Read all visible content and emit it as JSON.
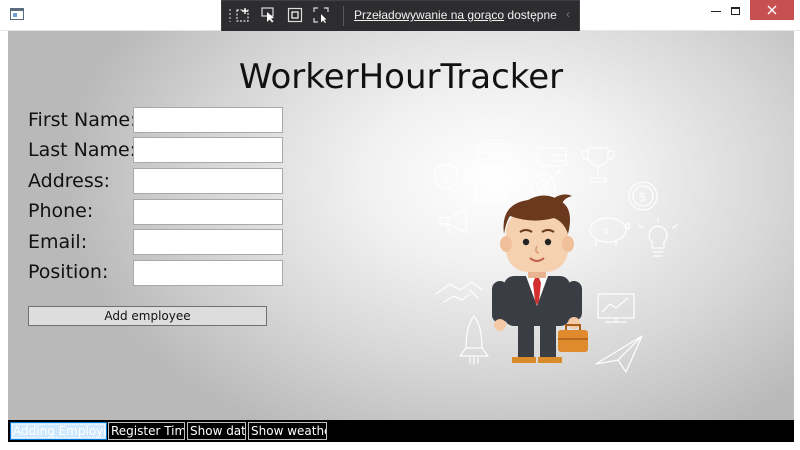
{
  "hot_reload": {
    "link_text": "Przeładowywanie na gorąco",
    "suffix_text": " dostępne"
  },
  "app": {
    "title": "WorkerHourTracker"
  },
  "form": {
    "fields": [
      {
        "label": "First Name:",
        "value": ""
      },
      {
        "label": "Last Name:",
        "value": ""
      },
      {
        "label": "Address:",
        "value": ""
      },
      {
        "label": "Phone:",
        "value": ""
      },
      {
        "label": "Email:",
        "value": ""
      },
      {
        "label": "Position:",
        "value": ""
      }
    ],
    "submit_label": "Add employee"
  },
  "nav": {
    "tabs": [
      {
        "label": "Adding Employee",
        "active": true
      },
      {
        "label": "Register Time",
        "active": false
      },
      {
        "label": "Show data",
        "active": false
      },
      {
        "label": "Show weather",
        "active": false
      }
    ]
  },
  "icons": {
    "app": "window-app-icon",
    "minimize": "minimize-icon",
    "maximize": "maximize-icon",
    "close": "close-icon",
    "hot_reload_tools": [
      "live-visual-tree-icon",
      "select-element-icon",
      "display-layout-adorners-icon",
      "track-focus-icon"
    ],
    "collapse": "chevron-left-icon"
  },
  "colors": {
    "close_button": "#c75050",
    "toolbar_bg": "#2d2d30",
    "active_tab": "#cde8ff",
    "suit": "#3a3d44",
    "tie": "#d32f2f",
    "briefcase": "#e08a2e"
  }
}
